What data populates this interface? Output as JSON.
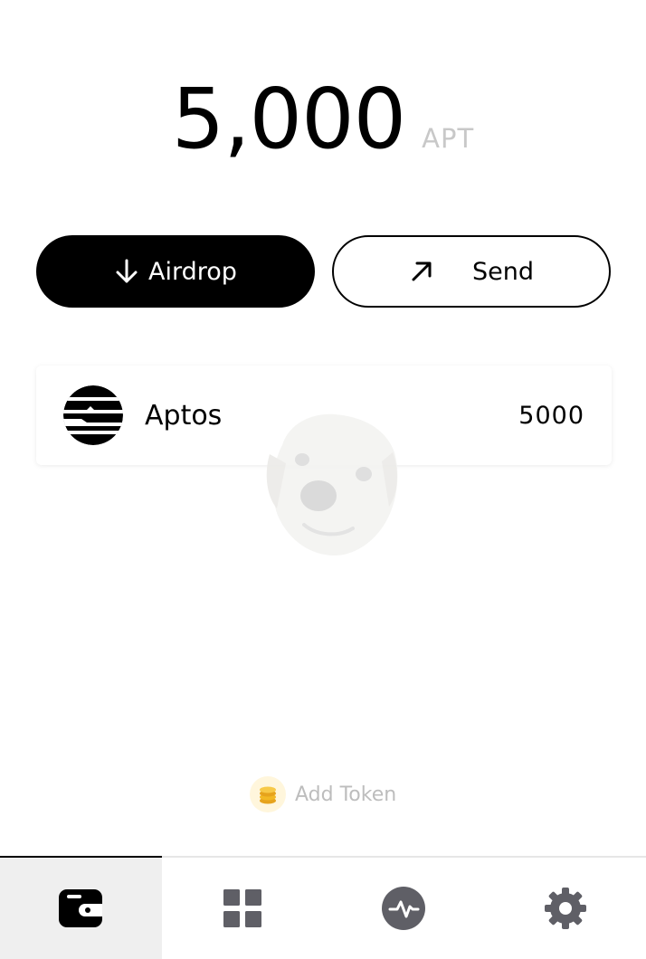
{
  "balance": {
    "amount": "5,000",
    "unit": "APT"
  },
  "actions": {
    "airdrop_label": "Airdrop",
    "airdrop_icon": "arrow-down-icon",
    "send_label": "Send",
    "send_icon": "arrow-up-right-icon"
  },
  "tokens": [
    {
      "name": "Aptos",
      "balance": "5000",
      "icon": "aptos-logo-icon"
    }
  ],
  "add_token": {
    "label": "Add Token",
    "icon": "coins-icon"
  },
  "bottom_nav": {
    "items": [
      {
        "name": "wallet",
        "icon": "wallet-icon",
        "active": true
      },
      {
        "name": "apps",
        "icon": "grid-icon",
        "active": false
      },
      {
        "name": "activity",
        "icon": "activity-icon",
        "active": false
      },
      {
        "name": "settings",
        "icon": "gear-icon",
        "active": false
      }
    ]
  },
  "colors": {
    "primary": "#000000",
    "muted_text": "#bdbdbd",
    "unit_text": "#c8c8c8",
    "nav_icon": "#5f5f66",
    "nav_active_bg": "#efefef",
    "coin_gold": "#f2b824"
  }
}
